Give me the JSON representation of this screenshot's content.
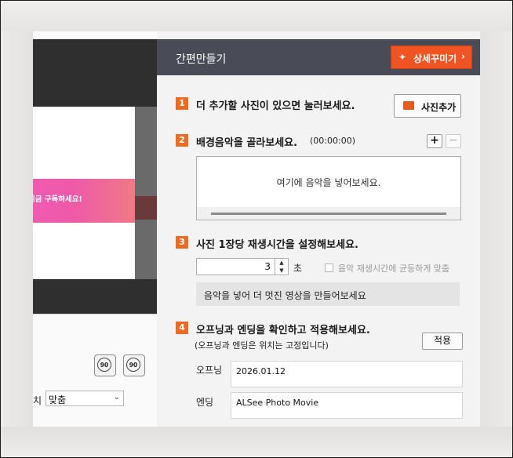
{
  "preview": {
    "banner_text": "지금 구독하세요!",
    "rotate_left_label": "90",
    "rotate_right_label": "90",
    "fit_label": "치",
    "fit_value": "맞춤"
  },
  "panel": {
    "title": "간편만들기",
    "detail_button": "상세꾸미기",
    "steps": [
      {
        "num": "1",
        "text": "더 추가할 사진이 있으면 눌러보세요.",
        "button": "사진추가"
      },
      {
        "num": "2",
        "text": "배경음악을 골라보세요.",
        "duration": "(00:00:00)",
        "add": "+",
        "remove": "−",
        "placeholder": "여기에 음악을 넣어보세요."
      },
      {
        "num": "3",
        "text": "사진 1장당 재생시간을 설정해보세요.",
        "seconds_value": "3",
        "seconds_unit": "초",
        "sync_label": "음악 재생시간에 균등하게 맞춤",
        "info": "음악을 넣어 더 멋진 영상을 만들어보세요"
      },
      {
        "num": "4",
        "text": "오프닝과 엔딩을 확인하고 적용해보세요.",
        "note": "(오프닝과 엔딩은 위치는 고정입니다)",
        "apply": "적용",
        "opening_label": "오프닝",
        "opening_value": "2026.01.12",
        "ending_label": "엔딩",
        "ending_value": "ALSee Photo Movie"
      }
    ]
  },
  "colors": {
    "header_bg": "#494b57",
    "accent": "#f05422",
    "step_badge": "#ef6b22"
  }
}
